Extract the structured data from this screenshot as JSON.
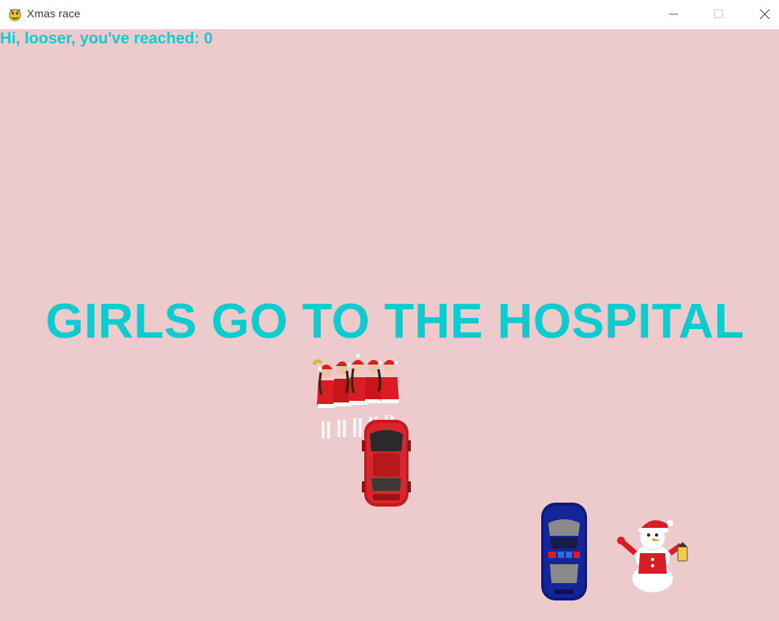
{
  "window": {
    "title": "Xmas race",
    "icon": "pygame-snake-icon",
    "controls": [
      "minimize-icon",
      "maximize-icon",
      "close-icon"
    ]
  },
  "game": {
    "background_color": "#edcacb",
    "text_color": "#0ccccf",
    "score_text": "Hi, looser, you've reached: 0",
    "message": "GIRLS GO TO THE HOSPITAL",
    "sprites": [
      "santa-girls-group",
      "red-car",
      "police-car",
      "snowman"
    ]
  }
}
